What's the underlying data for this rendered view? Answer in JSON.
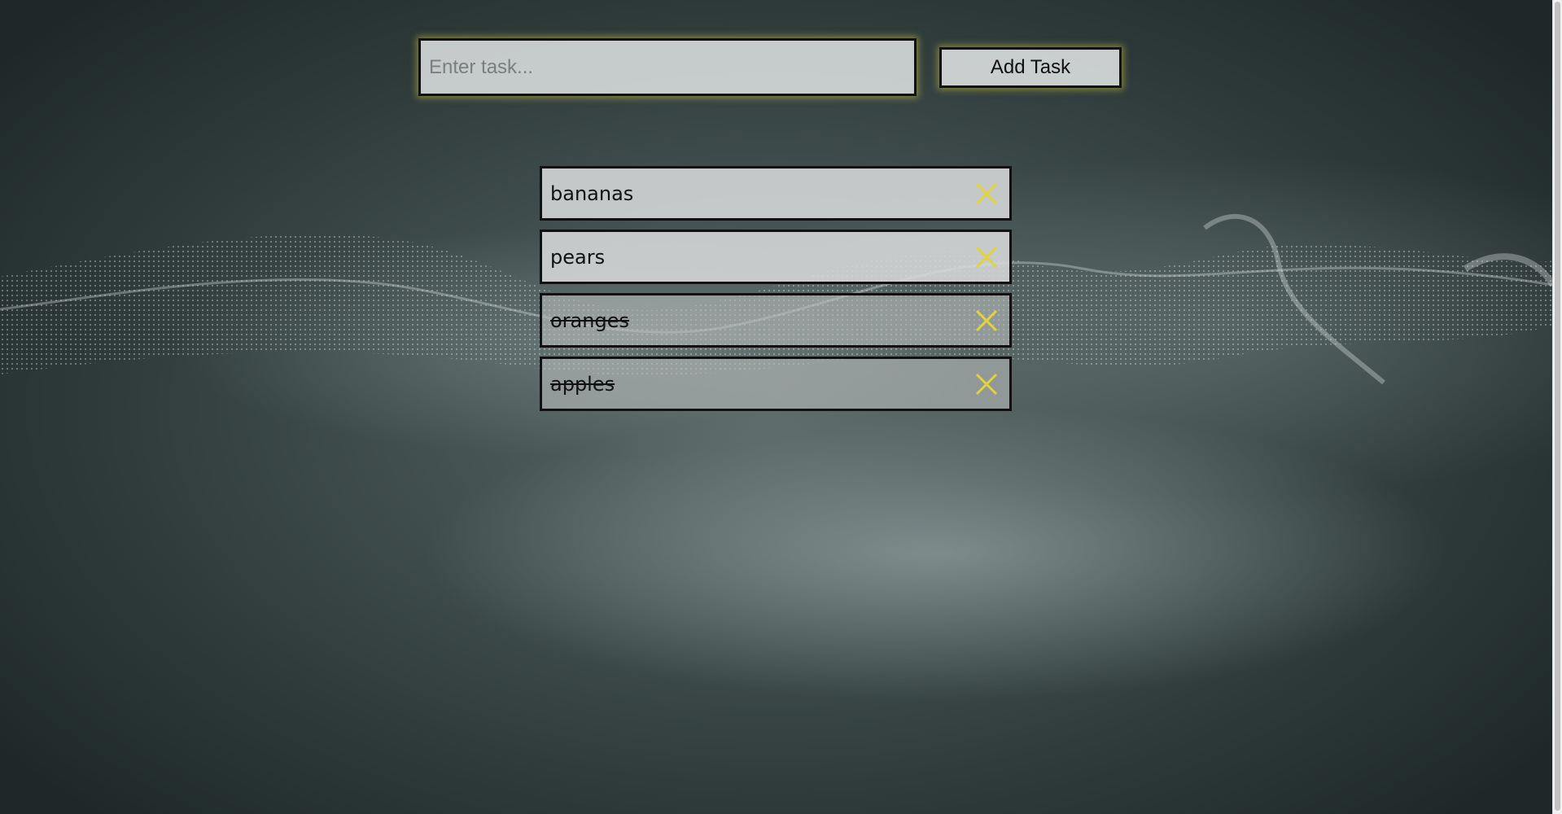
{
  "form": {
    "input_placeholder": "Enter task...",
    "input_value": "",
    "add_button_label": "Add Task"
  },
  "tasks": [
    {
      "text": "bananas",
      "done": false,
      "delete_icon": "close-x"
    },
    {
      "text": "pears",
      "done": false,
      "delete_icon": "close-x"
    },
    {
      "text": "oranges",
      "done": true,
      "delete_icon": "close-x"
    },
    {
      "text": "apples",
      "done": true,
      "delete_icon": "close-x"
    }
  ],
  "colors": {
    "accent": "#e3d23a",
    "glow": "#d2c83c",
    "border": "#111111"
  }
}
